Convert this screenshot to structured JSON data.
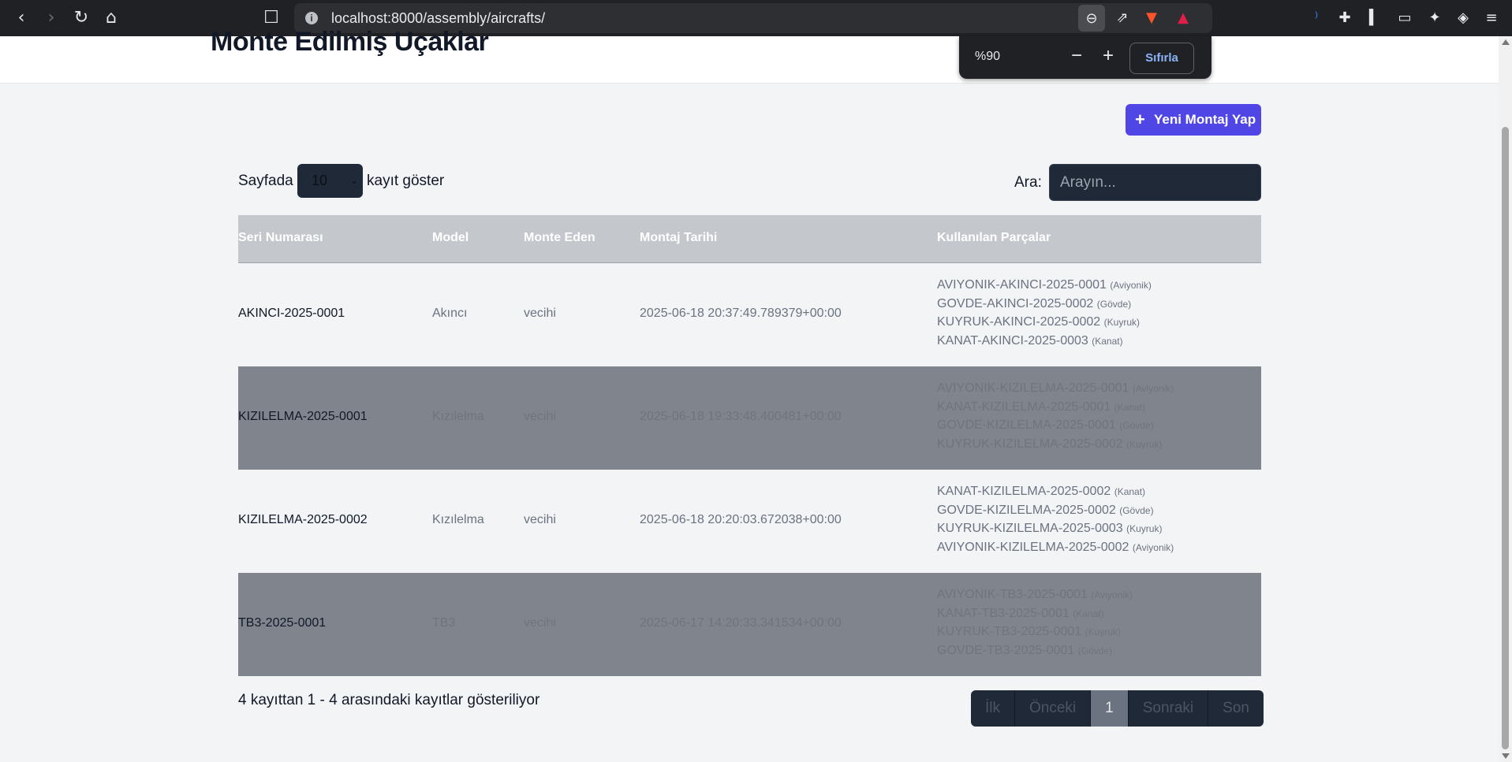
{
  "browser": {
    "url": "localhost:8000/assembly/aircrafts/",
    "zoom_value": "%90",
    "zoom_minus": "−",
    "zoom_plus": "+",
    "zoom_reset": "Sıfırla"
  },
  "page": {
    "title": "Monte Edilmiş Uçaklar",
    "add_button": "Yeni Montaj Yap",
    "length_prefix": "Sayfada",
    "length_value": "10",
    "length_suffix": "kayıt göster",
    "search_label": "Ara:",
    "search_placeholder": "Arayın..."
  },
  "table": {
    "headers": [
      "Seri Numarası",
      "Model",
      "Monte Eden",
      "Montaj Tarihi",
      "Kullanılan Parçalar"
    ],
    "rows": [
      {
        "serial": "AKINCI-2025-0001",
        "model": "Akıncı",
        "by": "vecihi",
        "date": "2025-06-18 20:37:49.789379+00:00",
        "parts": [
          {
            "code": "AVIYONIK-AKINCI-2025-0001",
            "type": "(Aviyonik)"
          },
          {
            "code": "GOVDE-AKINCI-2025-0002",
            "type": "(Gövde)"
          },
          {
            "code": "KUYRUK-AKINCI-2025-0002",
            "type": "(Kuyruk)"
          },
          {
            "code": "KANAT-AKINCI-2025-0003",
            "type": "(Kanat)"
          }
        ]
      },
      {
        "serial": "KIZILELMA-2025-0001",
        "model": "Kızılelma",
        "by": "vecihi",
        "date": "2025-06-18 19:33:48.400481+00:00",
        "parts": [
          {
            "code": "AVIYONIK-KIZILELMA-2025-0001",
            "type": "(Aviyonik)"
          },
          {
            "code": "KANAT-KIZILELMA-2025-0001",
            "type": "(Kanat)"
          },
          {
            "code": "GOVDE-KIZILELMA-2025-0001",
            "type": "(Gövde)"
          },
          {
            "code": "KUYRUK-KIZILELMA-2025-0002",
            "type": "(Kuyruk)"
          }
        ]
      },
      {
        "serial": "KIZILELMA-2025-0002",
        "model": "Kızılelma",
        "by": "vecihi",
        "date": "2025-06-18 20:20:03.672038+00:00",
        "parts": [
          {
            "code": "KANAT-KIZILELMA-2025-0002",
            "type": "(Kanat)"
          },
          {
            "code": "GOVDE-KIZILELMA-2025-0002",
            "type": "(Gövde)"
          },
          {
            "code": "KUYRUK-KIZILELMA-2025-0003",
            "type": "(Kuyruk)"
          },
          {
            "code": "AVIYONIK-KIZILELMA-2025-0002",
            "type": "(Aviyonik)"
          }
        ]
      },
      {
        "serial": "TB3-2025-0001",
        "model": "TB3",
        "by": "vecihi",
        "date": "2025-06-17 14:20:33.341534+00:00",
        "parts": [
          {
            "code": "AVIYONIK-TB3-2025-0001",
            "type": "(Aviyonik)"
          },
          {
            "code": "KANAT-TB3-2025-0001",
            "type": "(Kanat)"
          },
          {
            "code": "KUYRUK-TB3-2025-0001",
            "type": "(Kuyruk)"
          },
          {
            "code": "GOVDE-TB3-2025-0001",
            "type": "(Gövde)"
          }
        ]
      }
    ]
  },
  "footer": {
    "info": "4 kayıttan 1 - 4 arasındaki kayıtlar gösteriliyor",
    "pager": [
      "İlk",
      "Önceki",
      "1",
      "Sonraki",
      "Son"
    ]
  }
}
